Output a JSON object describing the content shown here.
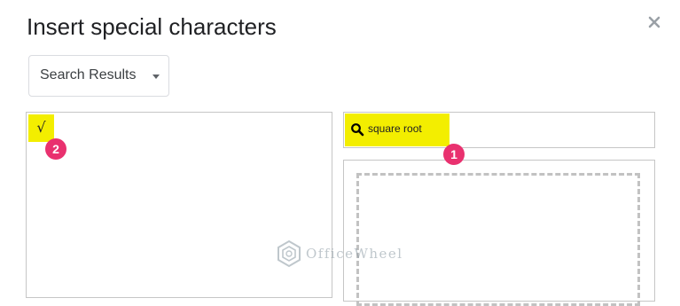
{
  "dialog": {
    "title": "Insert special characters",
    "close_icon": "close-icon"
  },
  "category": {
    "selected": "Search Results",
    "icon": "dropdown-caret-icon"
  },
  "results": {
    "characters": [
      "√"
    ],
    "highlight_color": "#f3ee00"
  },
  "search": {
    "value": "square root",
    "icon": "search-icon"
  },
  "annotations": {
    "step_1": "1",
    "step_2": "2",
    "badge_color": "#e9316f"
  },
  "watermark": {
    "text": "OfficeWheel",
    "icon": "officewheel-logo-icon"
  }
}
